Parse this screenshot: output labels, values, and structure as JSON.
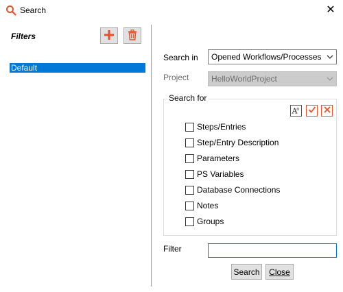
{
  "window": {
    "title": "Search",
    "close_glyph": "✕",
    "accent_color": "#e8502a",
    "selection_color": "#0078d7"
  },
  "filters": {
    "heading": "Filters",
    "add_icon": "plus-icon",
    "delete_icon": "trash-icon",
    "items": [
      {
        "label": "Default",
        "selected": true
      }
    ]
  },
  "search_in": {
    "label": "Search in",
    "value": "Opened Workflows/Processes"
  },
  "project": {
    "label": "Project",
    "value": "HelloWorldProject",
    "disabled": true
  },
  "search_for": {
    "legend": "Search for",
    "tool_icons": [
      "font-case-icon",
      "check-all-icon",
      "uncheck-all-icon"
    ],
    "options": [
      {
        "label": "Steps/Entries",
        "checked": false
      },
      {
        "label": "Step/Entry Description",
        "checked": false
      },
      {
        "label": "Parameters",
        "checked": false
      },
      {
        "label": "PS Variables",
        "checked": false
      },
      {
        "label": "Database Connections",
        "checked": false
      },
      {
        "label": "Notes",
        "checked": false
      },
      {
        "label": "Groups",
        "checked": false
      }
    ]
  },
  "filter": {
    "label": "Filter",
    "value": ""
  },
  "buttons": {
    "search": "Search",
    "close": "Close"
  }
}
